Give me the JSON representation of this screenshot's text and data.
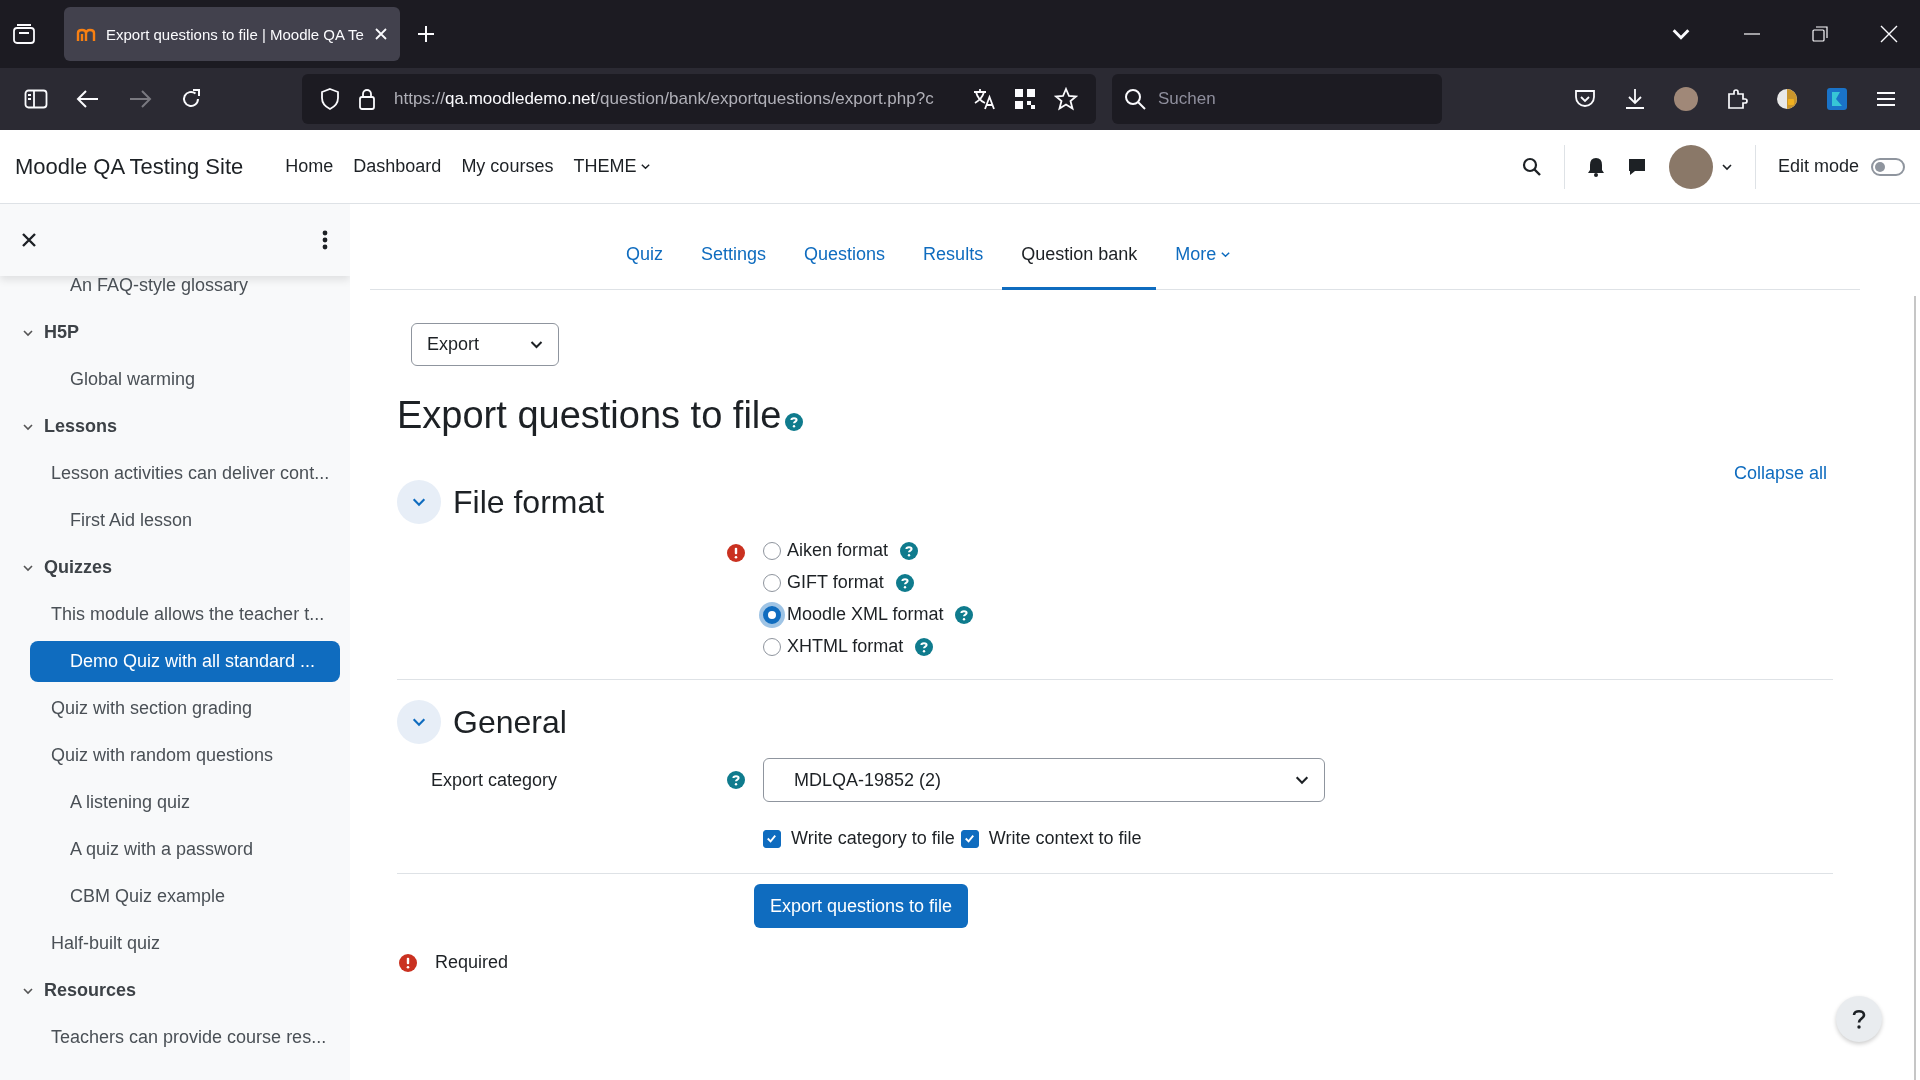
{
  "browser": {
    "tab_title": "Export questions to file | Moodle QA Te",
    "url": {
      "scheme": "https://",
      "host": "qa.moodledemo.net",
      "path": "/question/bank/exportquestions/export.php?c"
    },
    "search": {
      "placeholder": "Suchen"
    }
  },
  "site": {
    "name": "Moodle QA Testing Site",
    "nav": [
      {
        "label": "Home",
        "dropdown": false
      },
      {
        "label": "Dashboard",
        "dropdown": false
      },
      {
        "label": "My courses",
        "dropdown": false
      },
      {
        "label": "THEME",
        "dropdown": true
      }
    ],
    "edit_mode": {
      "label": "Edit mode",
      "on": false
    }
  },
  "sidebar": {
    "items": [
      {
        "kind": "activity",
        "label": "An FAQ-style glossary",
        "selected": false
      },
      {
        "kind": "section",
        "label": "H5P",
        "expanded": true,
        "children": [
          {
            "kind": "activity",
            "label": "Global warming",
            "selected": false
          }
        ]
      },
      {
        "kind": "section",
        "label": "Lessons",
        "expanded": true,
        "children": [
          {
            "kind": "text",
            "label": "Lesson activities can deliver cont...",
            "selected": false
          },
          {
            "kind": "activity",
            "label": "First Aid lesson",
            "selected": false
          }
        ]
      },
      {
        "kind": "section",
        "label": "Quizzes",
        "expanded": true,
        "children": [
          {
            "kind": "text",
            "label": "This module allows the teacher t...",
            "selected": false
          },
          {
            "kind": "activity",
            "label": "Demo Quiz with all standard ...",
            "selected": true
          },
          {
            "kind": "text",
            "label": "Quiz with section grading",
            "selected": false
          },
          {
            "kind": "text",
            "label": "Quiz with random questions",
            "selected": false
          },
          {
            "kind": "activity",
            "label": "A listening quiz",
            "selected": false
          },
          {
            "kind": "activity",
            "label": "A quiz with a password",
            "selected": false
          },
          {
            "kind": "activity",
            "label": "CBM Quiz example",
            "selected": false
          },
          {
            "kind": "text",
            "label": "Half-built quiz",
            "selected": false
          }
        ]
      },
      {
        "kind": "section",
        "label": "Resources",
        "expanded": true,
        "children": [
          {
            "kind": "text",
            "label": "Teachers can provide course res...",
            "selected": false
          }
        ]
      }
    ]
  },
  "tabs": [
    {
      "label": "Quiz",
      "selected": false,
      "dropdown": false
    },
    {
      "label": "Settings",
      "selected": false,
      "dropdown": false
    },
    {
      "label": "Questions",
      "selected": false,
      "dropdown": false
    },
    {
      "label": "Results",
      "selected": false,
      "dropdown": false
    },
    {
      "label": "Question bank",
      "selected": true,
      "dropdown": false
    },
    {
      "label": "More",
      "selected": false,
      "dropdown": true
    }
  ],
  "action_select": {
    "value": "Export"
  },
  "heading": "Export questions to file",
  "collapse_all": "Collapse all",
  "sections": [
    {
      "title": "File format",
      "expanded": true,
      "fields": [
        {
          "kind": "radios",
          "required": true,
          "options": [
            {
              "label": "Aiken format",
              "selected": false
            },
            {
              "label": "GIFT format",
              "selected": false
            },
            {
              "label": "Moodle XML format",
              "selected": true
            },
            {
              "label": "XHTML format",
              "selected": false
            }
          ]
        }
      ]
    },
    {
      "title": "General",
      "expanded": true,
      "fields": [
        {
          "kind": "select",
          "label": "Export category",
          "value": "MDLQA-19852 (2)"
        },
        {
          "kind": "checkboxes",
          "options": [
            {
              "label": "Write category to file",
              "checked": true
            },
            {
              "label": "Write context to file",
              "checked": true
            }
          ]
        }
      ]
    }
  ],
  "submit": "Export questions to file",
  "required_note": "Required"
}
